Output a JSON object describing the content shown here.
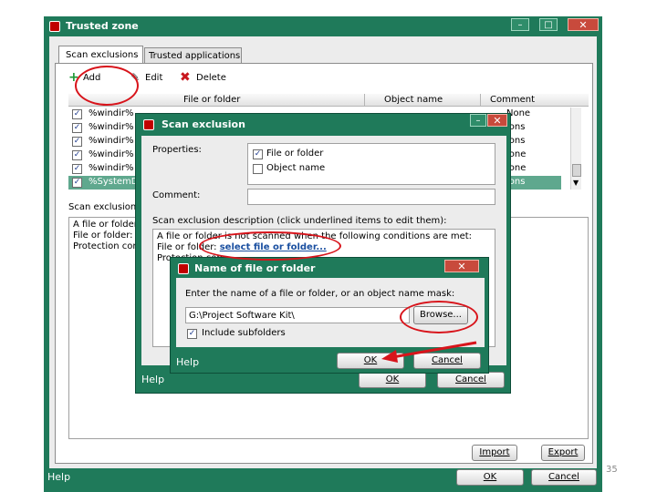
{
  "main_window": {
    "title": "Trusted zone",
    "tabs": [
      "Scan exclusions",
      "Trusted applications"
    ],
    "toolbar": {
      "add": "Add",
      "edit": "Edit",
      "delete": "Delete"
    },
    "columns": [
      "File or folder",
      "Object name",
      "Comment"
    ],
    "rows": [
      {
        "path": "%windir%",
        "comment": "None",
        "selected": false
      },
      {
        "path": "%windir%",
        "comment": "ions",
        "selected": false
      },
      {
        "path": "%windir%",
        "comment": "ions",
        "selected": false
      },
      {
        "path": "%windir%",
        "comment": "ione",
        "selected": false
      },
      {
        "path": "%windir%",
        "comment": "ione",
        "selected": false
      },
      {
        "path": "%SystemD",
        "comment": "ions",
        "selected": true
      }
    ],
    "desc_label": "Scan exclusion",
    "desc_lines": [
      "A file or folder",
      "File or folder:",
      "Protection cor"
    ],
    "import_label": "Import",
    "export_label": "Export",
    "help": "Help",
    "ok": "OK",
    "cancel": "Cancel"
  },
  "scan_dialog": {
    "title": "Scan exclusion",
    "properties_label": "Properties:",
    "property_file": "File or folder",
    "property_object": "Object name",
    "comment_label": "Comment:",
    "desc_label": "Scan exclusion description (click underlined items to edit them):",
    "desc_line1": "A file or folder is not scanned when the following conditions are met:",
    "desc_line2_prefix": "File or folder:",
    "desc_link": "select file or folder...",
    "desc_line3": "Protection com",
    "help": "Help",
    "ok": "OK",
    "cancel": "Cancel"
  },
  "name_dialog": {
    "title": "Name of file or folder",
    "instruction": "Enter the name of a file or folder, or an object name mask:",
    "path_value": "G:\\Project Software Kit\\",
    "browse": "Browse...",
    "include_subfolders": "Include subfolders",
    "help": "Help",
    "ok": "OK",
    "cancel": "Cancel"
  },
  "slide_number": "35",
  "colors": {
    "frame": "#1f7a5a",
    "accent": "#d8141b",
    "link": "#1a4fa0",
    "selected_row": "#5fa88e"
  }
}
